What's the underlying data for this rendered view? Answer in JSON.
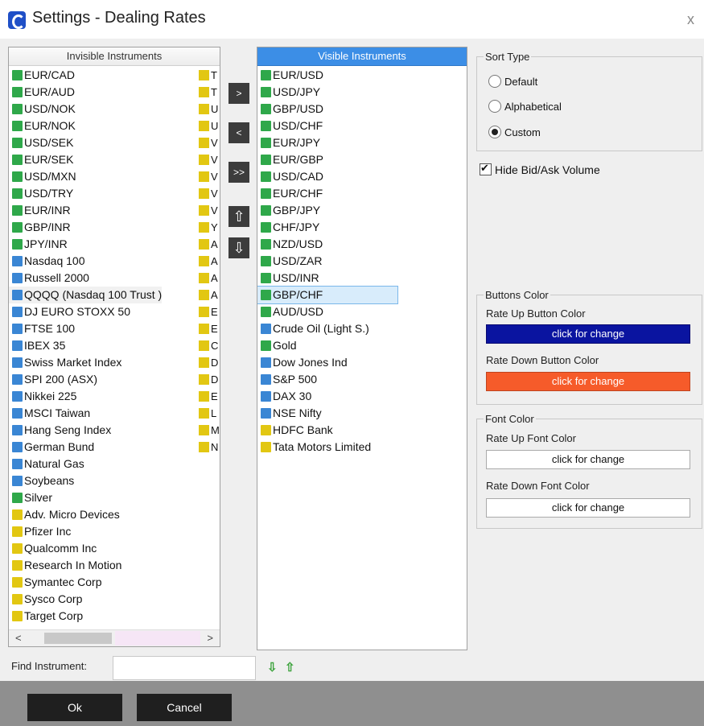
{
  "window": {
    "title": "Settings - Dealing Rates",
    "close": "x"
  },
  "invisible": {
    "header": "Invisible Instruments",
    "items": [
      {
        "label": "EUR/CAD",
        "type": "cur"
      },
      {
        "label": "EUR/AUD",
        "type": "cur"
      },
      {
        "label": "USD/NOK",
        "type": "cur"
      },
      {
        "label": "EUR/NOK",
        "type": "cur"
      },
      {
        "label": "USD/SEK",
        "type": "cur"
      },
      {
        "label": "EUR/SEK",
        "type": "cur"
      },
      {
        "label": "USD/MXN",
        "type": "cur"
      },
      {
        "label": "USD/TRY",
        "type": "cur"
      },
      {
        "label": "EUR/INR",
        "type": "cur"
      },
      {
        "label": "GBP/INR",
        "type": "cur"
      },
      {
        "label": "JPY/INR",
        "type": "cur"
      },
      {
        "label": "Nasdaq 100",
        "type": "idx"
      },
      {
        "label": "Russell 2000",
        "type": "idx"
      },
      {
        "label": "QQQQ (Nasdaq 100 Trust )",
        "type": "idx"
      },
      {
        "label": "DJ EURO STOXX 50",
        "type": "idx"
      },
      {
        "label": "FTSE 100",
        "type": "idx"
      },
      {
        "label": "IBEX 35",
        "type": "idx"
      },
      {
        "label": "Swiss Market Index",
        "type": "idx"
      },
      {
        "label": "SPI 200 (ASX)",
        "type": "idx"
      },
      {
        "label": "Nikkei 225",
        "type": "idx"
      },
      {
        "label": "MSCI Taiwan",
        "type": "idx"
      },
      {
        "label": "Hang Seng Index",
        "type": "idx"
      },
      {
        "label": "German Bund",
        "type": "idx"
      },
      {
        "label": "Natural Gas",
        "type": "idx"
      },
      {
        "label": "Soybeans",
        "type": "idx"
      },
      {
        "label": "Silver",
        "type": "cur"
      },
      {
        "label": "Adv. Micro Devices",
        "type": "stk"
      },
      {
        "label": "Pfizer Inc",
        "type": "stk"
      },
      {
        "label": "Qualcomm Inc",
        "type": "stk"
      },
      {
        "label": "Research In Motion",
        "type": "stk"
      },
      {
        "label": "Symantec Corp",
        "type": "stk"
      },
      {
        "label": "Sysco Corp",
        "type": "stk"
      },
      {
        "label": "Target Corp",
        "type": "stk"
      }
    ],
    "col2": [
      "T",
      "T",
      "U",
      "U",
      "V",
      "V",
      "V",
      "V",
      "V",
      "Y",
      "A",
      "A",
      "A",
      "A",
      "E",
      "E",
      "C",
      "D",
      "D",
      "E",
      "L",
      "M",
      "N"
    ],
    "scroll_left": "<",
    "scroll_right": ">"
  },
  "transfer_buttons": [
    ">",
    "<",
    ">>"
  ],
  "move_buttons": [
    "⇧",
    "⇩"
  ],
  "visible": {
    "header": "Visible Instruments",
    "items": [
      {
        "label": "EUR/USD",
        "type": "cur"
      },
      {
        "label": "USD/JPY",
        "type": "cur"
      },
      {
        "label": "GBP/USD",
        "type": "cur"
      },
      {
        "label": "USD/CHF",
        "type": "cur"
      },
      {
        "label": "EUR/JPY",
        "type": "cur"
      },
      {
        "label": "EUR/GBP",
        "type": "cur"
      },
      {
        "label": "USD/CAD",
        "type": "cur"
      },
      {
        "label": "EUR/CHF",
        "type": "cur"
      },
      {
        "label": "GBP/JPY",
        "type": "cur"
      },
      {
        "label": "CHF/JPY",
        "type": "cur"
      },
      {
        "label": "NZD/USD",
        "type": "cur"
      },
      {
        "label": "USD/ZAR",
        "type": "cur"
      },
      {
        "label": "USD/INR",
        "type": "cur"
      },
      {
        "label": "GBP/CHF",
        "type": "cur"
      },
      {
        "label": "AUD/USD",
        "type": "cur"
      },
      {
        "label": "Crude Oil (Light S.)",
        "type": "idx"
      },
      {
        "label": "Gold",
        "type": "cur"
      },
      {
        "label": "Dow Jones Ind",
        "type": "idx"
      },
      {
        "label": "S&P 500",
        "type": "idx"
      },
      {
        "label": "DAX 30",
        "type": "idx"
      },
      {
        "label": "NSE Nifty",
        "type": "idx"
      },
      {
        "label": "HDFC Bank",
        "type": "stk"
      },
      {
        "label": "Tata Motors Limited",
        "type": "stk"
      }
    ],
    "selected": "GBP/CHF"
  },
  "sort": {
    "title": "Sort Type",
    "options": [
      "Default",
      "Alphabetical",
      "Custom"
    ],
    "selected": "Custom"
  },
  "hide_volume": {
    "label": "Hide Bid/Ask Volume",
    "checked": true
  },
  "buttons_color": {
    "title": "Buttons Color",
    "up_label": "Rate Up Button Color",
    "up_button": "click for change",
    "up_color": "#0a14a0",
    "down_label": "Rate Down Button Color",
    "down_button": "click for change",
    "down_color": "#f65b2a"
  },
  "font_color": {
    "title": "Font Color",
    "up_label": "Rate Up Font Color",
    "up_button": "click for change",
    "down_label": "Rate Down Font Color",
    "down_button": "click for change"
  },
  "find": {
    "label": "Find Instrument:",
    "value": "",
    "down_arrow": "⇩",
    "up_arrow": "⇧"
  },
  "footer": {
    "ok": "Ok",
    "cancel": "Cancel"
  }
}
